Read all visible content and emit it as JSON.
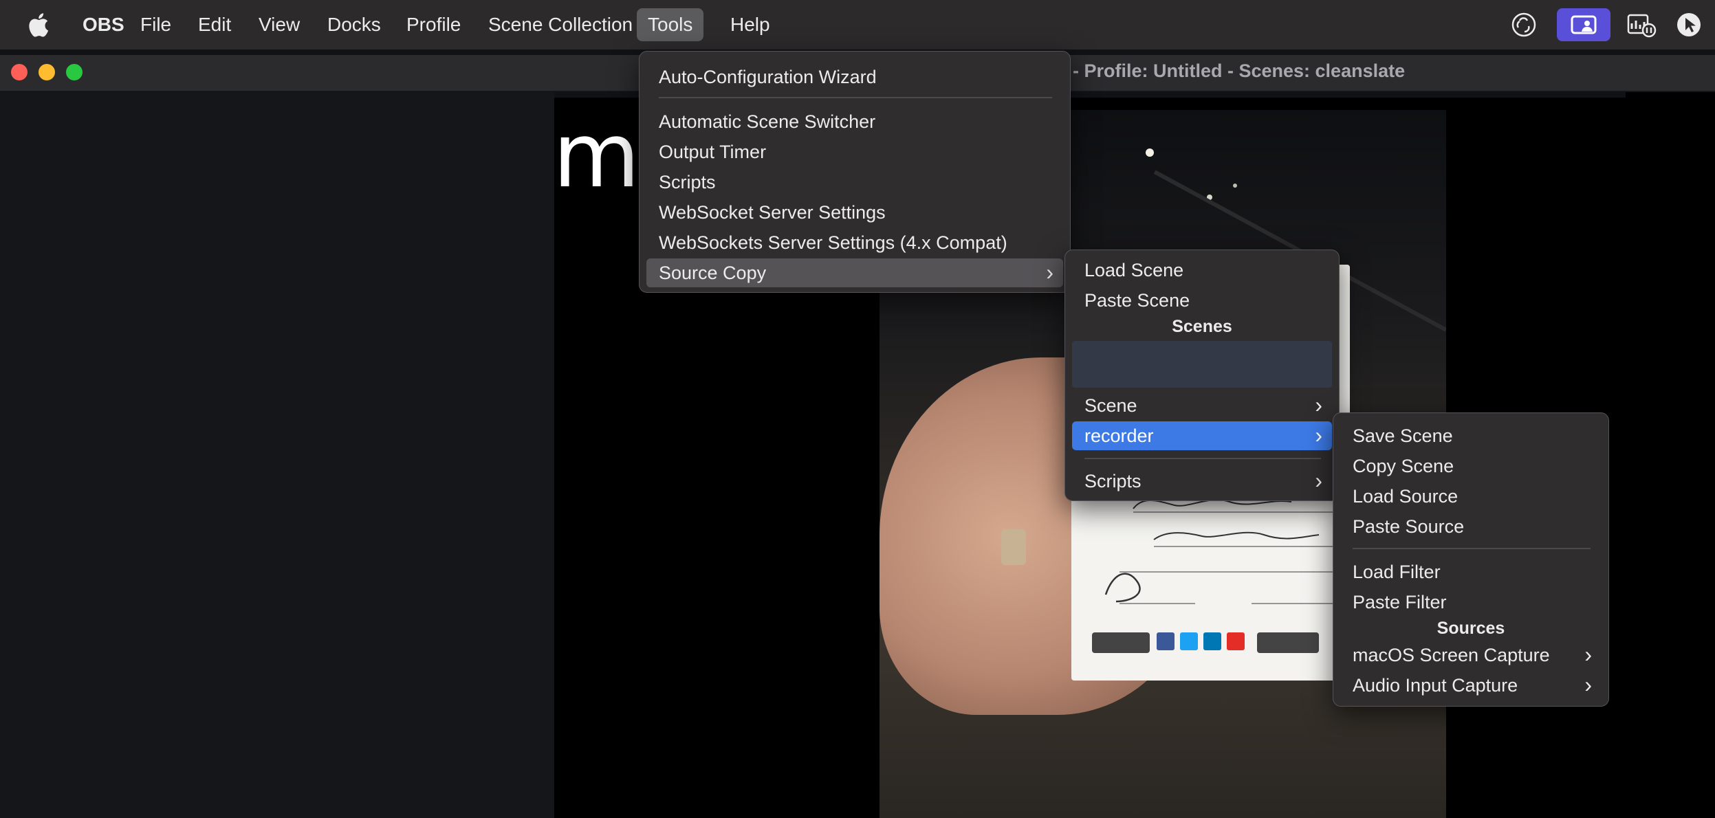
{
  "menubar": {
    "apple_icon": "apple-logo",
    "app_name": "OBS",
    "items": [
      "File",
      "Edit",
      "View",
      "Docks",
      "Profile",
      "Scene Collection",
      "Tools",
      "Help"
    ],
    "active_item": "Tools",
    "tray_icons": [
      "obs-icon",
      "screen-share-icon",
      "activity-monitor-icon",
      "cursor-icon"
    ]
  },
  "window": {
    "title_visible": "- Profile: Untitled - Scenes: cleanslate"
  },
  "preview": {
    "text": "my"
  },
  "tools_menu": {
    "items": [
      {
        "label": "Auto-Configuration Wizard"
      },
      {
        "label": "Automatic Scene Switcher"
      },
      {
        "label": "Output Timer"
      },
      {
        "label": "Scripts"
      },
      {
        "label": "WebSocket Server Settings"
      },
      {
        "label": "WebSockets Server Settings (4.x Compat)"
      },
      {
        "label": "Source Copy",
        "submenu": true,
        "highlighted": true
      }
    ]
  },
  "source_copy_menu": {
    "load_scene": "Load Scene",
    "paste_scene": "Paste Scene",
    "scenes_header": "Scenes",
    "scene": "Scene",
    "recorder": "recorder",
    "scripts": "Scripts"
  },
  "recorder_menu": {
    "save_scene": "Save Scene",
    "copy_scene": "Copy Scene",
    "load_source": "Load Source",
    "paste_source": "Paste Source",
    "load_filter": "Load Filter",
    "paste_filter": "Paste Filter",
    "sources_header": "Sources",
    "source_1": "macOS Screen Capture",
    "source_2": "Audio Input Capture"
  },
  "colors": {
    "menubar_bg": "#2c2a2a",
    "menu_bg": "#2f2d2e",
    "selection_blue": "#3d7ae6",
    "screen_share_purple": "#5a4fd8"
  }
}
